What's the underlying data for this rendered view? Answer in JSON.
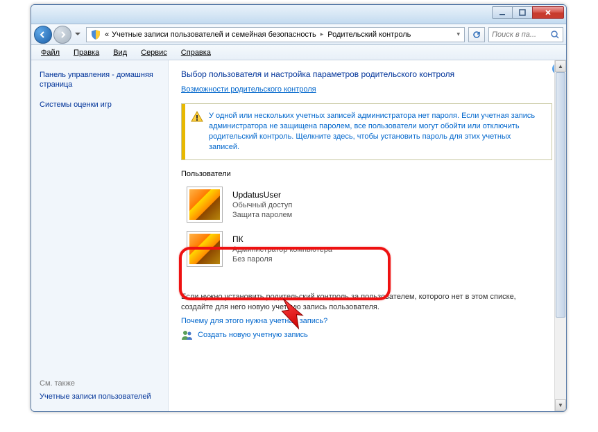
{
  "titlebar": {},
  "nav": {
    "crumb1_pre": "«",
    "crumb1": " Учетные записи пользователей и семейная безопасность ",
    "crumb2": " Родительский контроль",
    "search_placeholder": "Поиск в па..."
  },
  "menu": {
    "file": "Файл",
    "edit": "Правка",
    "view": "Вид",
    "tools": "Сервис",
    "help": "Справка"
  },
  "sidebar": {
    "link1": "Панель управления - домашняя страница",
    "link2": "Системы оценки игр",
    "see_also_label": "См. также",
    "link3": "Учетные записи пользователей"
  },
  "content": {
    "heading": "Выбор пользователя и настройка параметров родительского контроля",
    "capabilities_link": "Возможности родительского контроля",
    "warning": "У одной или нескольких учетных записей администратора нет пароля. Если учетная запись администратора не защищена паролем, все пользователи могут обойти или отключить родительский контроль. Щелкните здесь, чтобы установить пароль для этих учетных записей.",
    "users_label": "Пользователи",
    "users": [
      {
        "name": "UpdatusUser",
        "line2": "Обычный доступ",
        "line3": "Защита паролем"
      },
      {
        "name": "ПК",
        "line2": "Администратор компьютера",
        "line3": "Без пароля"
      }
    ],
    "bottom_hint": "Если нужно установить родительский контроль за пользователем, которого нет в этом списке, создайте для него новую учетную запись пользователя.",
    "why_link": "Почему для этого нужна учетная запись?",
    "create_link": "Создать новую учетную запись"
  }
}
